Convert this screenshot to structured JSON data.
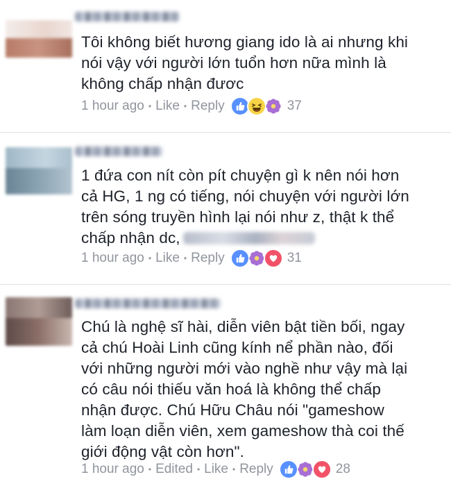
{
  "comments": [
    {
      "text": "Tôi không biết hương giang ido là ai nhưng khi\nnói vậy với người lớn tuổn hơn nữa mình là\nkhông chấp nhận đươc",
      "time": "1 hour ago",
      "like": "Like",
      "reply": "Reply",
      "reactions": [
        "like-icon",
        "haha-icon",
        "thankful-flower-icon"
      ],
      "count": "37"
    },
    {
      "text": "1 đứa con nít còn pít chuyện gì k nên nói hơn\ncả HG, 1 ng có tiếng, nói chuyện với người lớn\ntrên sóng truyền hình lại nói như z, thật k thể\nchấp nhận dc,",
      "time": "1 hour ago",
      "like": "Like",
      "reply": "Reply",
      "reactions": [
        "like-icon",
        "thankful-flower-icon",
        "love-icon"
      ],
      "count": "31"
    },
    {
      "text": "Chú là nghệ sĩ hài, diễn viên bật tiền bối, ngay\ncả chú Hoài Linh cũng kính nể phần nào, đối\nvới những người mới vào nghề như vậy mà lại\ncó câu nói thiếu văn hoá là không thể chấp\nnhận được. Chú Hữu Châu nói  \"gameshow\nlàm loạn diễn viên, xem gameshow thà coi thế\ngiới động vật còn hơn\".",
      "time": "1 hour ago",
      "edited": "Edited",
      "like": "Like",
      "reply": "Reply",
      "reactions": [
        "like-icon",
        "thankful-flower-icon",
        "love-icon"
      ],
      "count": "28"
    }
  ],
  "colors": {
    "text": "#1d2129",
    "meta": "#90949c",
    "like": "#5890ff",
    "haha": "#f7d447",
    "love": "#f25268",
    "thankful": "#a86ed3"
  }
}
